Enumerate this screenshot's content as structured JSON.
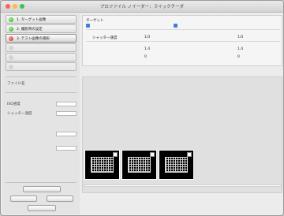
{
  "window": {
    "title": "プロファイル ノイーダー：ライックチーダ",
    "traffic_colors": [
      "#fc615d",
      "#fdbc40",
      "#34c84a"
    ]
  },
  "sidebar": {
    "steps": [
      {
        "label": "1. ターゲット画像",
        "state": "done"
      },
      {
        "label": "2. 撮影時の設定",
        "state": "done"
      },
      {
        "label": "3. テスト画像の選択",
        "state": "active"
      },
      {
        "label": "",
        "state": "disabled"
      },
      {
        "label": "",
        "state": "disabled"
      },
      {
        "label": "",
        "state": "disabled"
      }
    ],
    "file_section_label": "ファイル名",
    "fields_header": "",
    "fields": [
      {
        "label": "ISO感度",
        "value": ""
      },
      {
        "label": "シャッター速度",
        "value": ""
      }
    ],
    "field3_label": "",
    "field4_label": "",
    "buttons": {
      "main": "",
      "left": "",
      "right": "",
      "cancel": ""
    }
  },
  "summary": {
    "header_label": "ターゲット",
    "header_note": "",
    "left": {
      "title": "",
      "rows": [
        {
          "label": "シャッター速度",
          "value": "1/3"
        },
        {
          "label": "",
          "value": "1.4"
        },
        {
          "label": "",
          "value": "0"
        }
      ]
    },
    "right": {
      "title": "",
      "rows": [
        {
          "label": "",
          "value": "1/3"
        },
        {
          "label": "",
          "value": "1.4"
        },
        {
          "label": "",
          "value": "0"
        }
      ]
    }
  },
  "thumbnails": [
    {
      "caption": ""
    },
    {
      "caption": ""
    },
    {
      "caption": ""
    }
  ],
  "note": {
    "lines": [
      "",
      "",
      "",
      "",
      ""
    ]
  }
}
